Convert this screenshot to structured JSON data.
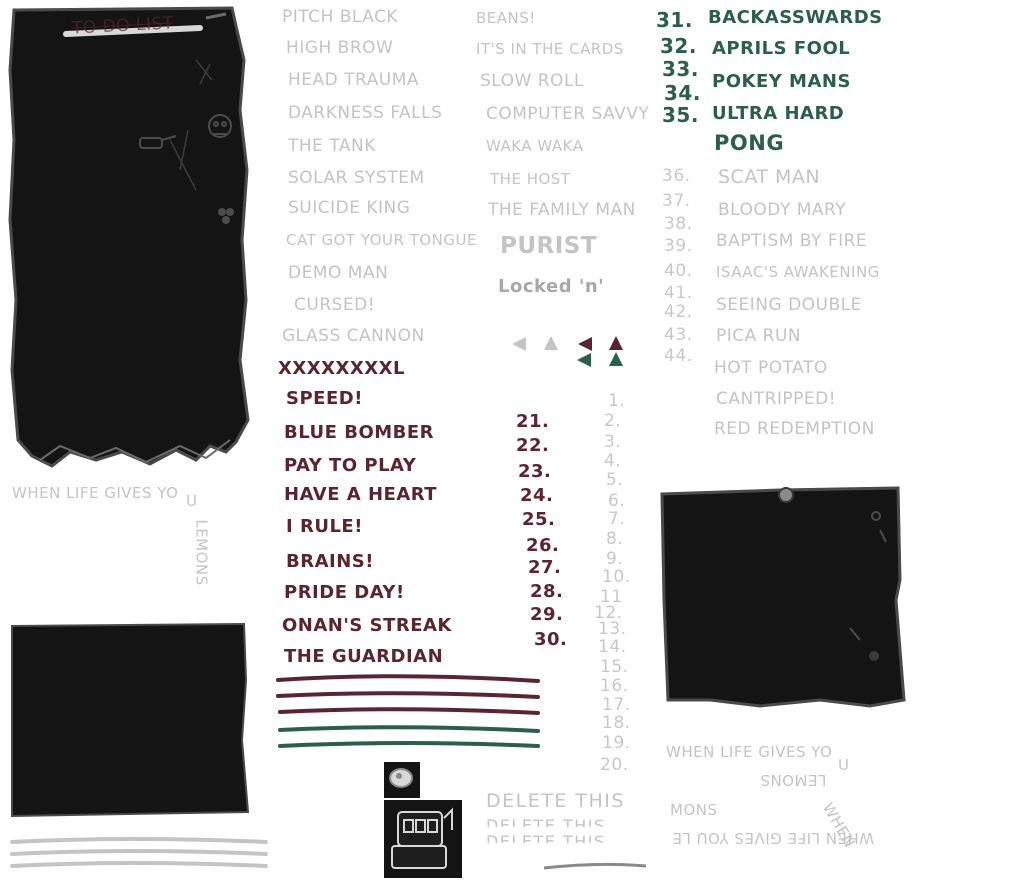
{
  "paper_title": "To Do List",
  "colors": {
    "paper": "#141414",
    "paper_edge": "#555555",
    "locked_text": "#c4c4c4",
    "unlocked_text": "#5a2530",
    "hard_text": "#2c5e4e"
  },
  "icons": [
    "padlock-icon",
    "slot-machine-icon",
    "skull-doodle-icon",
    "tank-doodle-icon",
    "poop-doodle-icon",
    "pin-icon",
    "arrow-left-gray-icon",
    "arrow-up-gray-icon",
    "arrow-left-maroon-icon",
    "arrow-up-maroon-icon",
    "arrow-left-green-icon",
    "arrow-up-green-icon"
  ],
  "col1": [
    "Pitch Black",
    "High Brow",
    "Head Trauma",
    "Darkness Falls",
    "The Tank",
    "Solar System",
    "Suicide King",
    "Cat Got Your Tongue",
    "Demo Man",
    "Cursed!",
    "Glass Cannon"
  ],
  "col1_unlocked": [
    "XXXXXXXXL",
    "Speed!",
    "Blue Bomber",
    "Pay To Play",
    "Have A Heart",
    "I Rule!",
    "Brains!",
    "Pride Day!",
    "Onan's Streak",
    "The Guardian"
  ],
  "col2": [
    "Beans!",
    "It's In The Cards",
    "Slow Roll",
    "Computer Savvy",
    "Waka Waka",
    "The Host",
    "The Family Man"
  ],
  "purist": "Purist",
  "locked": "Locked 'n'",
  "nums_maroon": [
    "21.",
    "22.",
    "23.",
    "24.",
    "25.",
    "26.",
    "27.",
    "28.",
    "29.",
    "30."
  ],
  "nums_gray": [
    "1.",
    "2.",
    "3.",
    "4.",
    "5.",
    "6.",
    "7.",
    "8.",
    "9.",
    "10.",
    "11",
    "12.",
    "13.",
    "14.",
    "15.",
    "16.",
    "17.",
    "18.",
    "19.",
    "20."
  ],
  "nums_green": [
    "31.",
    "32.",
    "33.",
    "34.",
    "35."
  ],
  "col3_green": [
    "Backasswards",
    "Aprils Fool",
    "Pokey Mans",
    "Ultra Hard"
  ],
  "pong": "Pong",
  "nums_gray2": [
    "36.",
    "37.",
    "38.",
    "39.",
    "40.",
    "41.",
    "42.",
    "43.",
    "44."
  ],
  "col3_gray": [
    "Scat Man",
    "Bloody Mary",
    "Baptism By Fire",
    "Isaac's Awakening",
    "Seeing Double",
    "Pica Run",
    "Hot Potato",
    "Cantripped!",
    "Red Redemption"
  ],
  "lemons_1": "When life gives yo",
  "lemons_1b": "u",
  "lemons_2": "lemons",
  "lemons_3": "When life gives yo",
  "lemons_3b": "u",
  "lemons_4": "lemons",
  "lemons_5": "When life gives you le",
  "lemons_5b": "mons",
  "lemons_5c": "when",
  "delete_this": "Delete this",
  "delete_this_2": "Delete this",
  "delete_this_3": "Delete this"
}
